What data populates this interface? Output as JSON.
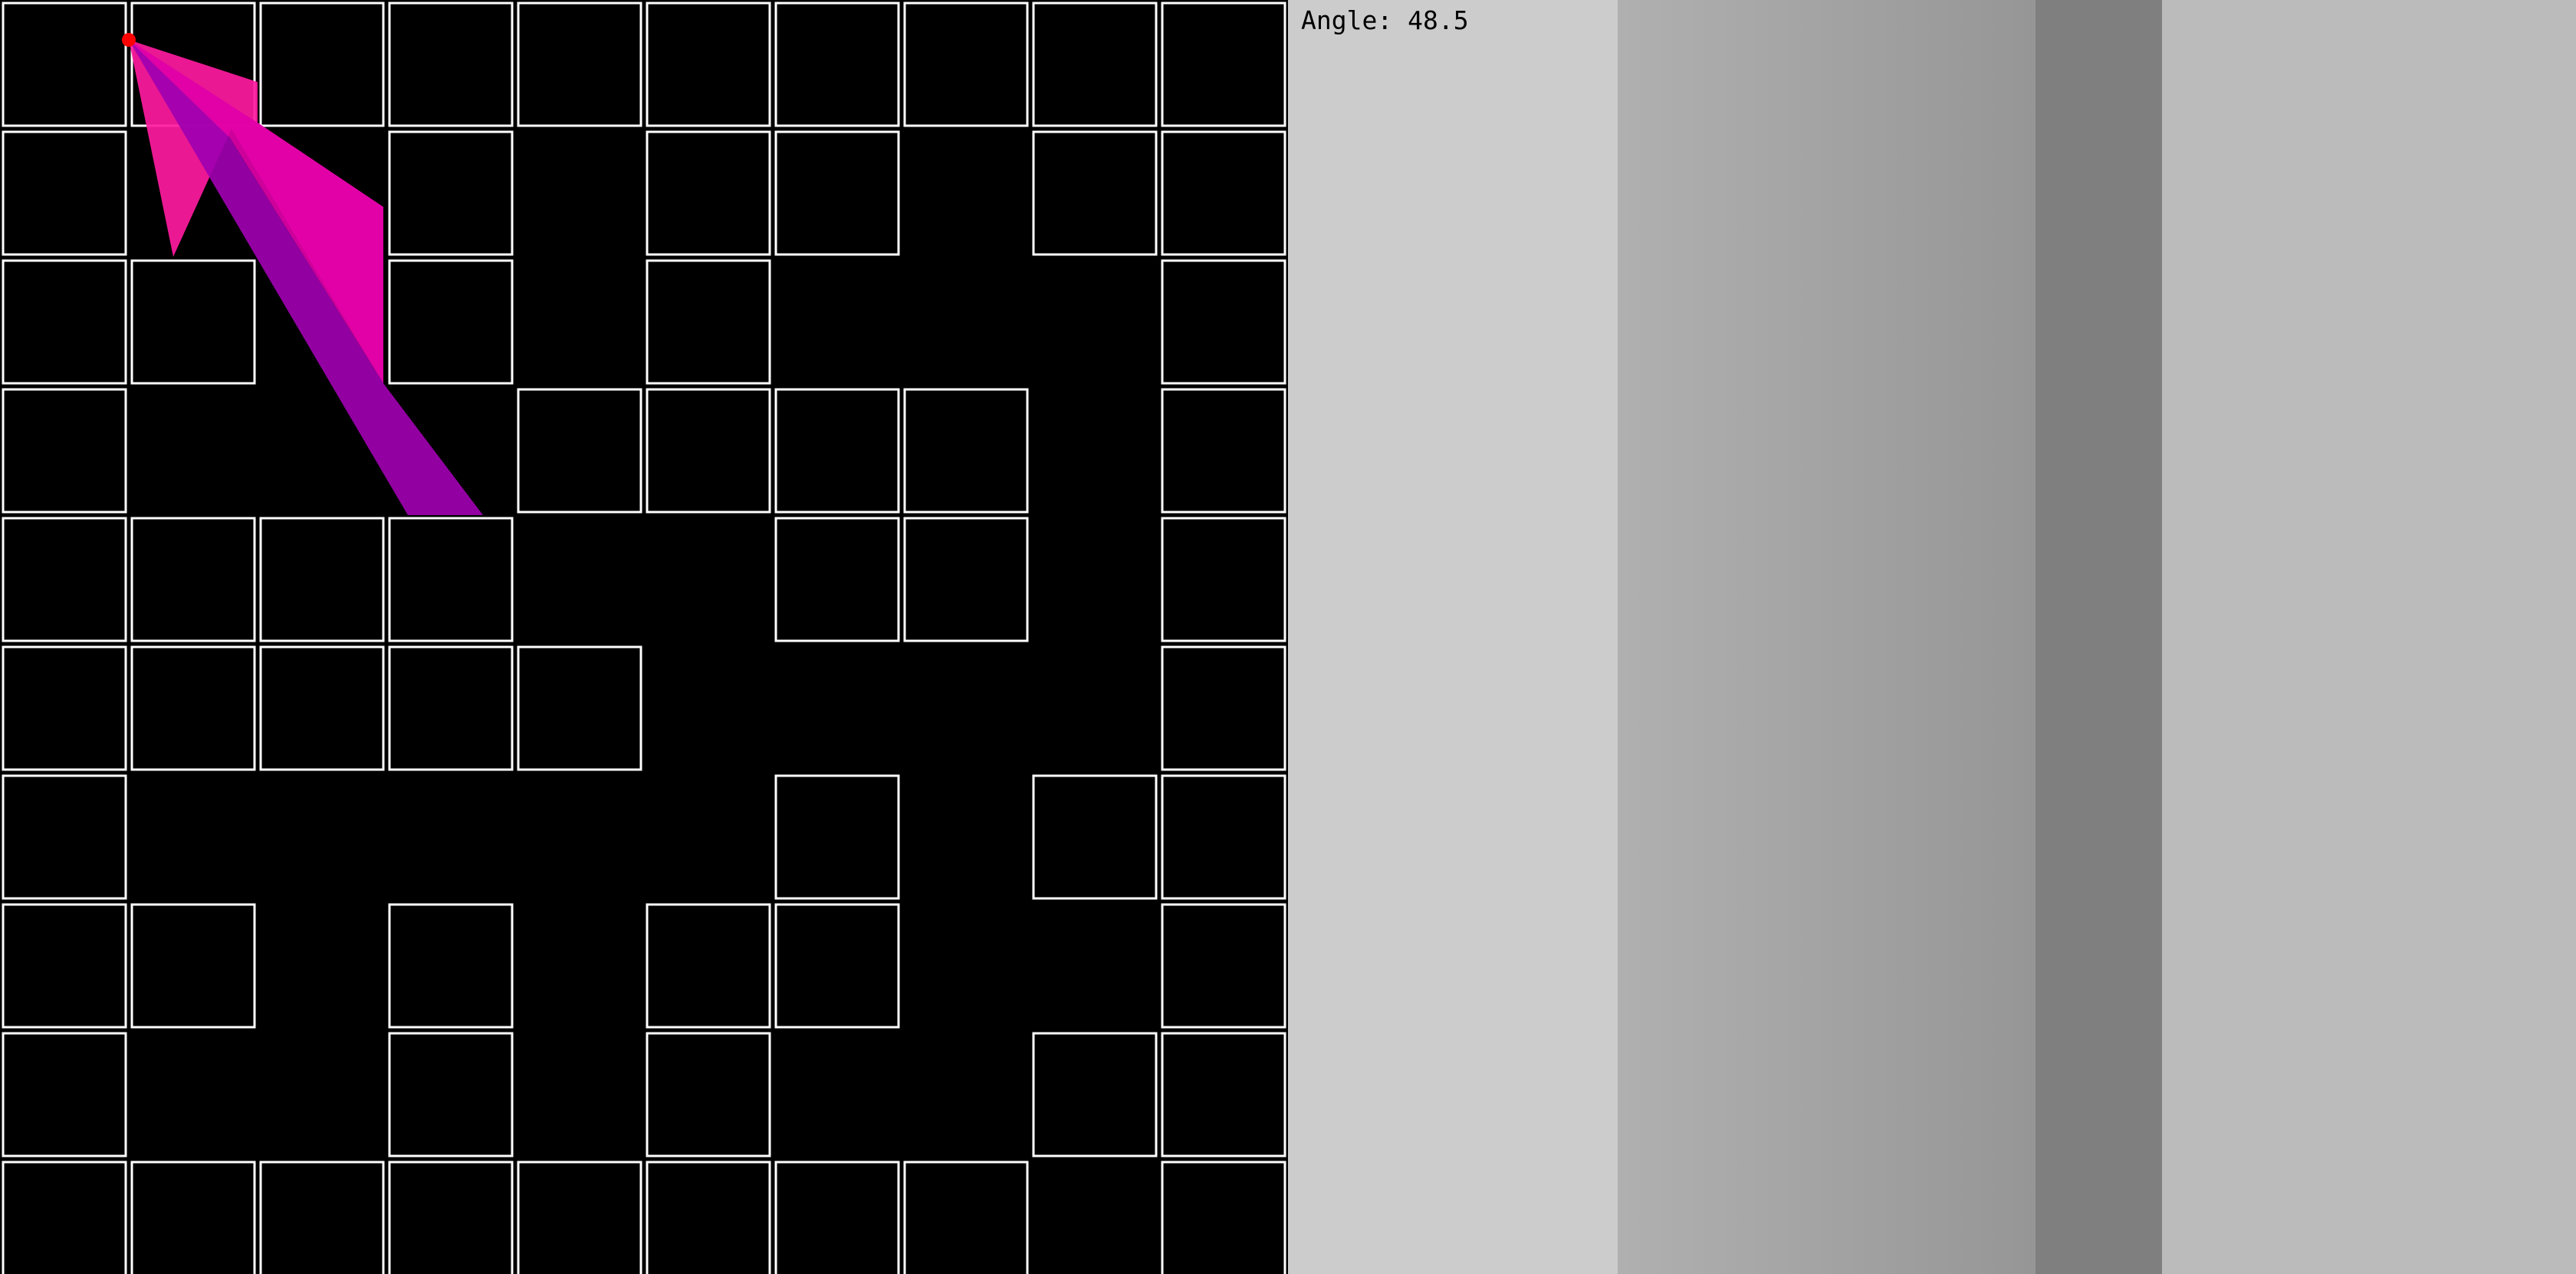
{
  "hud": {
    "angle_label": "Angle:",
    "angle_value": "48.5"
  },
  "maze": {
    "rows": 10,
    "cols": 10,
    "grid": [
      "##########",
      "#..#.##.##",
      "##.#.#...#",
      "#...####.#",
      "####..##.#",
      "#####....#",
      "#.....#.##",
      "##.#.##..#",
      "#..#.#..##",
      "########.#"
    ],
    "wall_color": "#000000",
    "wall_outline_color": "#ffffff",
    "floor_color": "#000000"
  },
  "player": {
    "color": "#ff0000",
    "cell_col": 1,
    "cell_row": 0,
    "fov_colors": [
      "#ff1aa0",
      "#e000a8",
      "#a000b0"
    ]
  },
  "render": {
    "background": "#cccccc",
    "slices": [
      {
        "shade": "#cccccc"
      },
      {
        "shade": "#a9a9a9"
      },
      {
        "shade": "#7f7f7f"
      },
      {
        "shade": "#bbbbbb"
      }
    ]
  }
}
